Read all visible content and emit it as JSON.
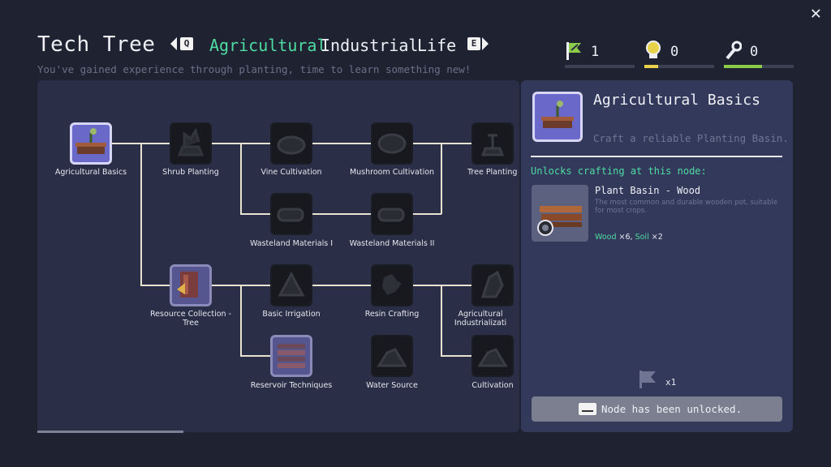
{
  "header": {
    "title": "Tech Tree",
    "subtitle": "You've gained experience through planting, time to learn something new!",
    "key_prev": "Q",
    "key_next": "E",
    "tabs": [
      {
        "label": "Agricultural",
        "active": true
      },
      {
        "label": "Industrial",
        "active": false
      },
      {
        "label": "Life",
        "active": false
      }
    ],
    "close_glyph": "✕"
  },
  "resources": [
    {
      "icon": "leaf-flag-icon",
      "value": "1",
      "progress": 0.0,
      "color": "#8ccc4a"
    },
    {
      "icon": "lightbulb-icon",
      "value": "0",
      "progress": 0.2,
      "color": "#e8d24a"
    },
    {
      "icon": "wrench-icon",
      "value": "0",
      "progress": 0.55,
      "color": "#8ccc4a"
    }
  ],
  "tree": {
    "nodes": [
      {
        "id": "agricultural-basics",
        "label": "Agricultural Basics",
        "state": "unlocked"
      },
      {
        "id": "shrub-planting",
        "label": "Shrub Planting",
        "state": "locked"
      },
      {
        "id": "vine-cultivation",
        "label": "Vine Cultivation",
        "state": "locked"
      },
      {
        "id": "mushroom-cultivation",
        "label": "Mushroom Cultivation",
        "state": "locked"
      },
      {
        "id": "tree-planting",
        "label": "Tree Planting",
        "state": "locked"
      },
      {
        "id": "wasteland-materials-1",
        "label": "Wasteland Materials I",
        "state": "locked"
      },
      {
        "id": "wasteland-materials-2",
        "label": "Wasteland Materials II",
        "state": "locked"
      },
      {
        "id": "resource-collection-tree",
        "label": "Resource Collection - Tree",
        "state": "available"
      },
      {
        "id": "basic-irrigation",
        "label": "Basic Irrigation",
        "state": "locked"
      },
      {
        "id": "resin-crafting",
        "label": "Resin Crafting",
        "state": "locked"
      },
      {
        "id": "agricultural-industrialization",
        "label": "Agricultural Industrializati",
        "state": "locked"
      },
      {
        "id": "reservoir-techniques",
        "label": "Reservoir Techniques",
        "state": "available"
      },
      {
        "id": "water-source",
        "label": "Water Source",
        "state": "locked"
      },
      {
        "id": "cultivation",
        "label": "Cultivation",
        "state": "locked"
      }
    ]
  },
  "detail": {
    "title": "Agricultural Basics",
    "description": "Craft a reliable Planting Basin.",
    "unlocks_label": "Unlocks crafting at this node:",
    "item": {
      "name": "Plant Basin - Wood",
      "description": "The most common and durable wooden pot, suitable for most crops.",
      "costs": [
        {
          "material": "Wood",
          "qty": "×6"
        },
        {
          "material": "Soil",
          "qty": "×2"
        }
      ]
    },
    "cost_icon": "leaf-flag-icon",
    "cost_count": "x1",
    "button_label": "Node has been unlocked."
  }
}
